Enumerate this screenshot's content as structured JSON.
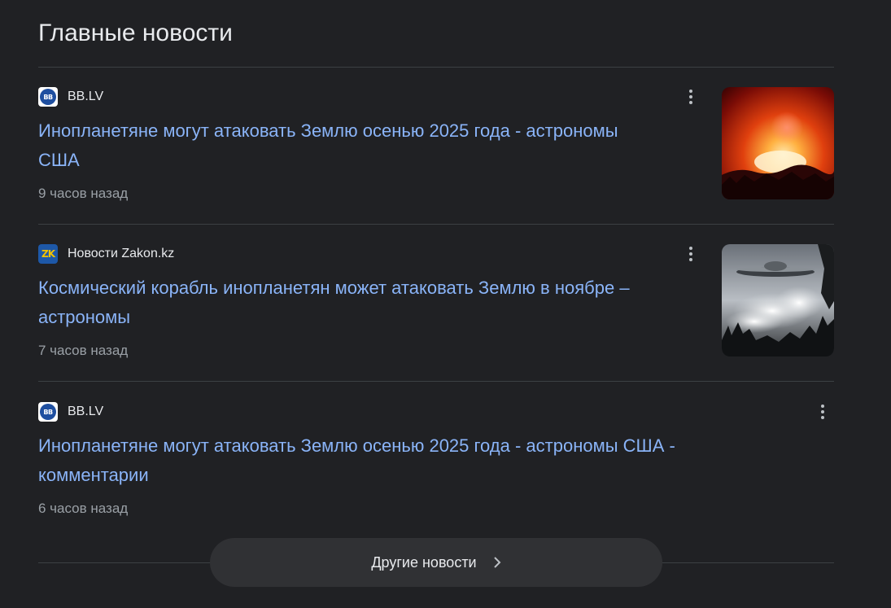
{
  "section": {
    "title": "Главные новости"
  },
  "stories": [
    {
      "source": "BB.LV",
      "favicon": "bb-lv-logo",
      "headline_line1": "Инопланетяне могут атаковать Землю осенью 2025 года - астрономы",
      "headline_line2": "США",
      "time": "9 часов назад",
      "thumbnail": "fiery-explosion-sky"
    },
    {
      "source": "Новости Zakon.kz",
      "favicon": "zakon-kz-logo",
      "headline_line1": "Космический корабль инопланетян может атаковать Землю в ноябре –",
      "headline_line2": "астрономы",
      "time": "7 часов назад",
      "thumbnail": "ufo-over-clouds"
    },
    {
      "source": "BB.LV",
      "favicon": "bb-lv-logo",
      "headline_line1": "Инопланетяне могут атаковать Землю осенью 2025 года - астрономы США -",
      "headline_line2": "комментарии",
      "time": "6 часов назад",
      "thumbnail": null
    }
  ],
  "more_button": {
    "label": "Другие новости",
    "icon": "chevron-right-icon"
  },
  "colors": {
    "background": "#202124",
    "link": "#8ab4f8",
    "secondary_text": "#9aa0a6",
    "divider": "#3c4043",
    "button_bg": "#303134"
  }
}
